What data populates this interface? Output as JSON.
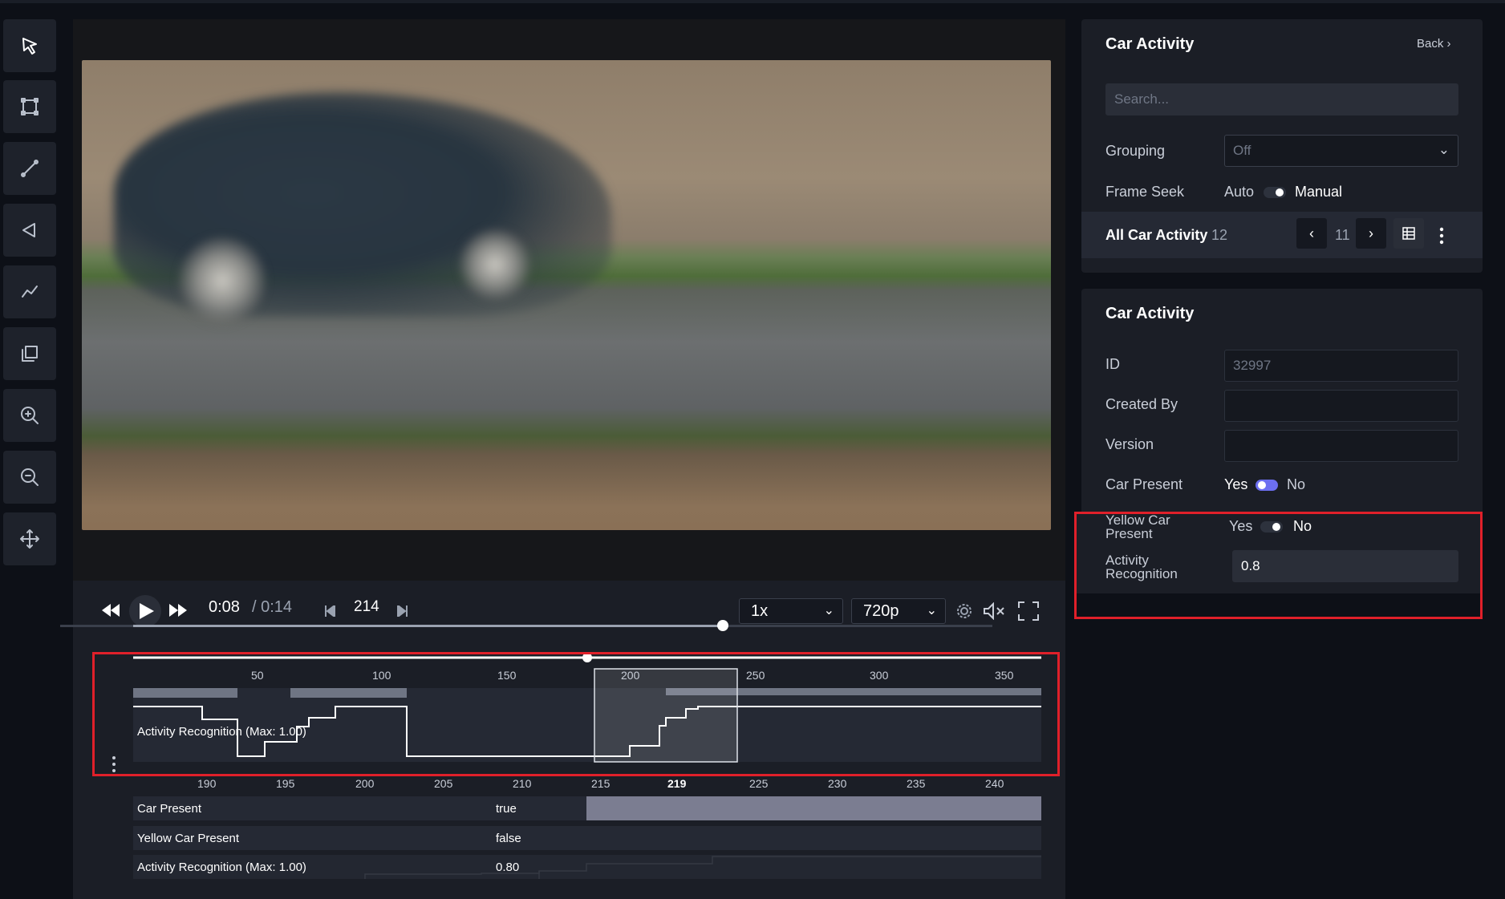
{
  "toolbar": {
    "tools": [
      "pointer-icon",
      "box-icon",
      "line-icon",
      "polygon-icon",
      "polyline-icon",
      "copy-icon",
      "zoom-in-icon",
      "zoom-out-icon",
      "move-icon"
    ]
  },
  "player": {
    "current_time": "0:08",
    "total_time": "/ 0:14",
    "frame_number": "214",
    "speed": "1x",
    "quality": "720p",
    "seek_progress": 0.64
  },
  "timeline": {
    "overview_ticks": [
      "50",
      "100",
      "150",
      "200",
      "250",
      "300",
      "350"
    ],
    "overview_label": "Activity Recognition (Max: 1.00)",
    "detail_ticks": [
      "190",
      "195",
      "200",
      "205",
      "210",
      "215",
      "219",
      "225",
      "230",
      "235",
      "240"
    ],
    "current_frame_tick": "219",
    "rows": [
      {
        "label": "Car Present",
        "value": "true"
      },
      {
        "label": "Yellow Car Present",
        "value": "false"
      },
      {
        "label": "Activity Recognition (Max: 1.00)",
        "value": "0.80"
      }
    ]
  },
  "panel_top": {
    "title": "Car Activity",
    "back_label": "Back",
    "search_placeholder": "Search...",
    "grouping_label": "Grouping",
    "grouping_value": "Off",
    "frame_seek_label": "Frame Seek",
    "frame_seek_auto": "Auto",
    "frame_seek_manual": "Manual",
    "all_label": "All Car Activity",
    "all_count": "12",
    "page_number": "11"
  },
  "panel_bottom": {
    "title": "Car Activity",
    "id_label": "ID",
    "id_value": "32997",
    "created_by_label": "Created By",
    "version_label": "Version",
    "car_present_label": "Car Present",
    "car_present_yes": "Yes",
    "car_present_no": "No",
    "yellow_label_line1": "Yellow Car",
    "yellow_label_line2": "Present",
    "yellow_yes": "Yes",
    "yellow_no": "No",
    "activity_label_line1": "Activity",
    "activity_label_line2": "Recognition",
    "activity_value": "0.8"
  },
  "colors": {
    "highlight": "#e0202a",
    "accent": "#6c6ff0",
    "panel": "#1b1e26"
  }
}
